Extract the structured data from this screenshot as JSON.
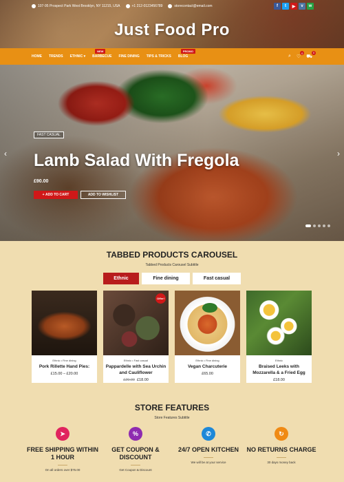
{
  "topbar": {
    "address": "107-95 Prospect Park West Brooklyn, NY 11215, USA",
    "phone": "+1 212-0123456789",
    "email": "storecontact@email.com",
    "socials": [
      {
        "icon": "facebook-icon",
        "glyph": "f",
        "color": "#3b5998"
      },
      {
        "icon": "twitter-icon",
        "glyph": "t",
        "color": "#1da1f2"
      },
      {
        "icon": "youtube-icon",
        "glyph": "▶",
        "color": "#d01818"
      },
      {
        "icon": "vk-icon",
        "glyph": "v",
        "color": "#4c75a3"
      },
      {
        "icon": "whatsapp-icon",
        "glyph": "w",
        "color": "#25a244"
      }
    ]
  },
  "site": {
    "title": "Just Food Pro"
  },
  "nav": {
    "items": [
      "HOME",
      "TRENDS",
      "ETHNIC",
      "BARBECUE",
      "FINE DINING",
      "TIPS & TRICKS",
      "BLOG"
    ],
    "badges": {
      "barbecue": "NEW",
      "blog": "PROMO"
    },
    "wishlist_count": "0",
    "cart_count": "0"
  },
  "hero": {
    "tag": "FAST CASUAL",
    "title": "Lamb Salad With Fregola",
    "price": "£90.00",
    "add_to_cart": "ADD TO CART",
    "add_to_wishlist": "ADD TO WISHLIST",
    "slides": 5,
    "active_slide": 1
  },
  "products": {
    "title": "TABBED PRODUCTS CAROUSEL",
    "subtitle": "Tabbed Products Carousel Subtitle",
    "tabs": [
      "Ethnic",
      "Fine dining",
      "Fast casual"
    ],
    "active_tab": 0,
    "items": [
      {
        "cats": "Ethnic • Fine dining",
        "name": "Pork Rillette Hand Pies:",
        "price_old": "",
        "price": "£15.00 – £20.00",
        "offer": ""
      },
      {
        "cats": "Ethnic • Fast casual",
        "name": "Pappardelle with Sea Urchin and Cauliflower",
        "price_old": "£20.00",
        "price": "£18.00",
        "offer": "Offer!"
      },
      {
        "cats": "Ethnic • Fine dining",
        "name": "Vegan Charcuterie",
        "price_old": "",
        "price": "£65.00",
        "offer": ""
      },
      {
        "cats": "Ethnic",
        "name": "Braised Leeks with Mozzarella & a Fried Egg",
        "price_old": "",
        "price": "£18.00",
        "offer": ""
      }
    ]
  },
  "features": {
    "title": "STORE FEATURES",
    "subtitle": "Store Features Subtitle",
    "items": [
      {
        "title": "FREE SHIPPING WITHIN 1 HOUR",
        "sub": "On all orders over $75.00",
        "color": "#e0245e",
        "icon": "shipping-icon",
        "glyph": "➤"
      },
      {
        "title": "GET COUPON & DISCOUNT",
        "sub": "Get Coupon & Discount",
        "color": "#8e2bb0",
        "icon": "coupon-icon",
        "glyph": "%"
      },
      {
        "title": "24/7 OPEN KITCHEN",
        "sub": "We will be at your service",
        "color": "#1e88d8",
        "icon": "kitchen-icon",
        "glyph": "✆"
      },
      {
        "title": "NO RETURNS CHARGE",
        "sub": "30 days money back",
        "color": "#f08a14",
        "icon": "returns-icon",
        "glyph": "↻"
      }
    ]
  }
}
